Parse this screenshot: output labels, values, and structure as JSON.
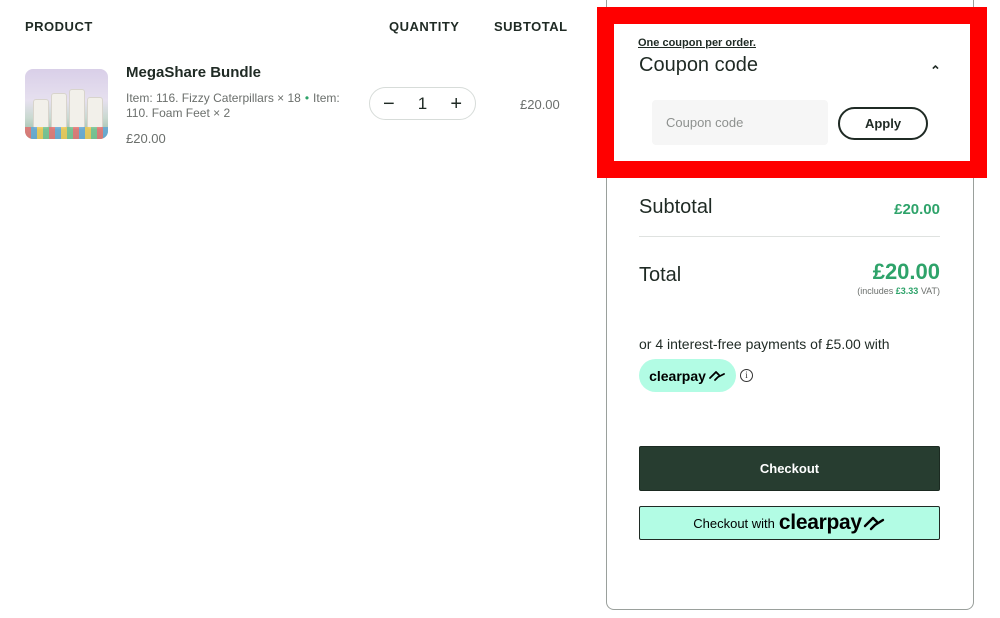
{
  "table_headers": {
    "product": "PRODUCT",
    "quantity": "QUANTITY",
    "subtotal": "SUBTOTAL"
  },
  "cart_item": {
    "name": "MegaShare Bundle",
    "meta_part1": "Item: 116. Fizzy Caterpillars × 18",
    "meta_part2": "Item: 110. Foam Feet × 2",
    "meta_separator": "•",
    "price": "£20.00",
    "quantity": "1",
    "minus_glyph": "−",
    "plus_glyph": "+",
    "line_subtotal": "£20.00"
  },
  "coupon": {
    "note": "One coupon per order.",
    "title": "Coupon code",
    "chevron_glyph": "⌃",
    "placeholder": "Coupon code",
    "apply_label": "Apply"
  },
  "totals": {
    "subtotal_label": "Subtotal",
    "subtotal_value": "£20.00",
    "total_label": "Total",
    "total_value": "£20.00",
    "vat_prefix": "(includes",
    "vat_amount": "£3.33",
    "vat_suffix": "VAT)"
  },
  "clearpay": {
    "installment_text": "or 4 interest-free payments of £5.00 with",
    "badge_label": "clearpay",
    "info_glyph": "i"
  },
  "buttons": {
    "checkout_label": "Checkout",
    "clearpay_checkout_prefix": "Checkout with",
    "clearpay_checkout_brand": "clearpay"
  },
  "colors": {
    "accent_green": "#2ea36a",
    "dark_green": "#273d30",
    "clearpay_mint": "#b2fce4",
    "highlight_red": "#ff0000"
  }
}
